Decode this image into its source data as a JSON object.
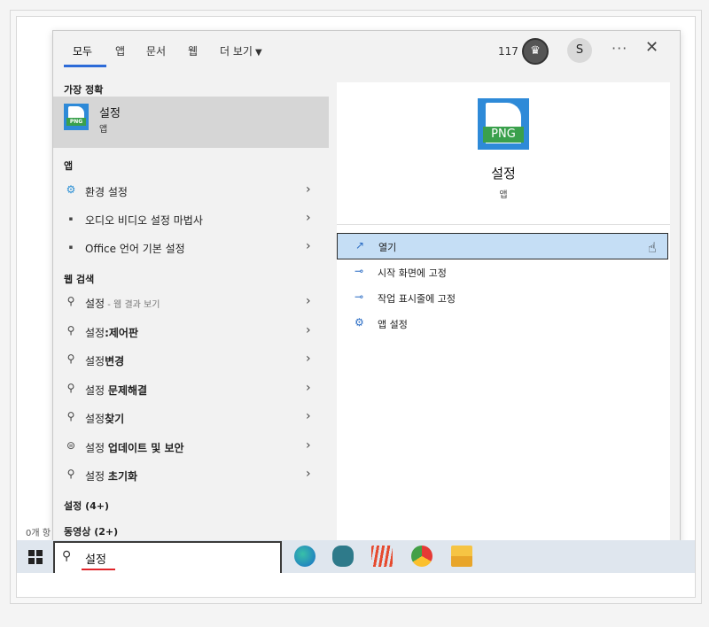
{
  "tabs": [
    "모두",
    "앱",
    "문서",
    "웹",
    "더 보기"
  ],
  "top": {
    "count": "117",
    "avatar": "S",
    "more": "···",
    "close": "✕"
  },
  "left": {
    "best_head": "가장 정확",
    "best_title": "설정",
    "best_sub": "앱",
    "png_label": "PNG",
    "apps_head": "앱",
    "apps": [
      {
        "icon": "gear-icon",
        "glyph": "⚙",
        "label": "환경 설정"
      },
      {
        "icon": "app-icon",
        "glyph": "▪",
        "label": "오디오 비디오 설정 마법사"
      },
      {
        "icon": "app-icon",
        "glyph": "▪",
        "label": "Office 언어 기본 설정"
      }
    ],
    "web_head": "웹 검색",
    "web": [
      {
        "prefix": "설정",
        "muted": " - 웹 결과 보기",
        "bold": ""
      },
      {
        "prefix": "설정",
        "muted": "",
        "bold": ":제어판"
      },
      {
        "prefix": "설정",
        "muted": "",
        "bold": "변경"
      },
      {
        "prefix": "설정 ",
        "muted": "",
        "bold": "문제해결"
      },
      {
        "prefix": "설정",
        "muted": "",
        "bold": "찾기"
      },
      {
        "prefix": "설정 ",
        "muted": "",
        "bold": "업데이트 및 보안"
      },
      {
        "prefix": "설정 ",
        "muted": "",
        "bold": "초기화"
      }
    ],
    "more1": "설정 (4+)",
    "more2": "동영상 (2+)"
  },
  "right": {
    "title": "설정",
    "sub": "앱",
    "png_label": "PNG",
    "actions": [
      {
        "icon": "open-icon",
        "glyph": "↗",
        "label": "열기"
      },
      {
        "icon": "pin-icon",
        "glyph": "⊸",
        "label": "시작 화면에 고정"
      },
      {
        "icon": "pin-icon",
        "glyph": "⊸",
        "label": "작업 표시줄에 고정"
      },
      {
        "icon": "gear-icon",
        "glyph": "⚙",
        "label": "앱 설정"
      }
    ]
  },
  "taskbar": {
    "search_value": "설정",
    "edge_text": "0개 항"
  },
  "colors": {
    "accent": "#2d6bd8",
    "highlight": "#c5def5",
    "png_blue": "#2e8ad8",
    "png_green": "#3aa04c",
    "underline": "#e0242a"
  }
}
